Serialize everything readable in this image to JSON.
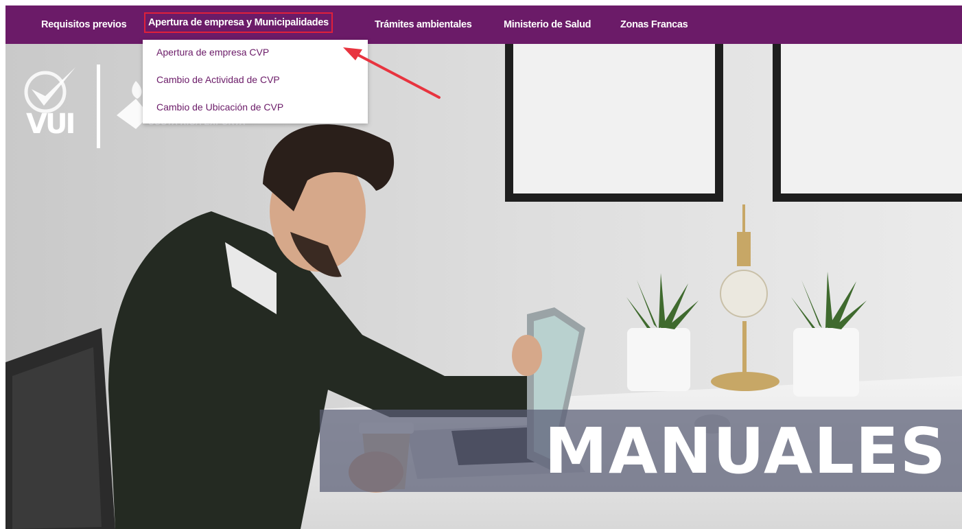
{
  "nav": {
    "items": [
      {
        "label": "Requisitos previos"
      },
      {
        "label": "Apertura de empresa y Municipalidades"
      },
      {
        "label": "Trámites ambientales"
      },
      {
        "label": "Ministerio de Salud"
      },
      {
        "label": "Zonas Francas"
      }
    ],
    "active_index": 1
  },
  "dropdown": {
    "items": [
      {
        "label": "Apertura de empresa CVP"
      },
      {
        "label": "Cambio de Actividad de CVP"
      },
      {
        "label": "Cambio de Ubicación de CVP"
      }
    ]
  },
  "hero": {
    "banner_text": "MANUALES",
    "logo_text": "VUI",
    "partner_text": "COSTA RICA EXPORTA"
  },
  "colors": {
    "nav_bg": "#6b1b68",
    "highlight": "#e0203a",
    "dropdown_text": "#6b1b68"
  },
  "icons": [
    "vui-check-logo",
    "costa-rica-exporta-logo",
    "annotation-arrow"
  ]
}
